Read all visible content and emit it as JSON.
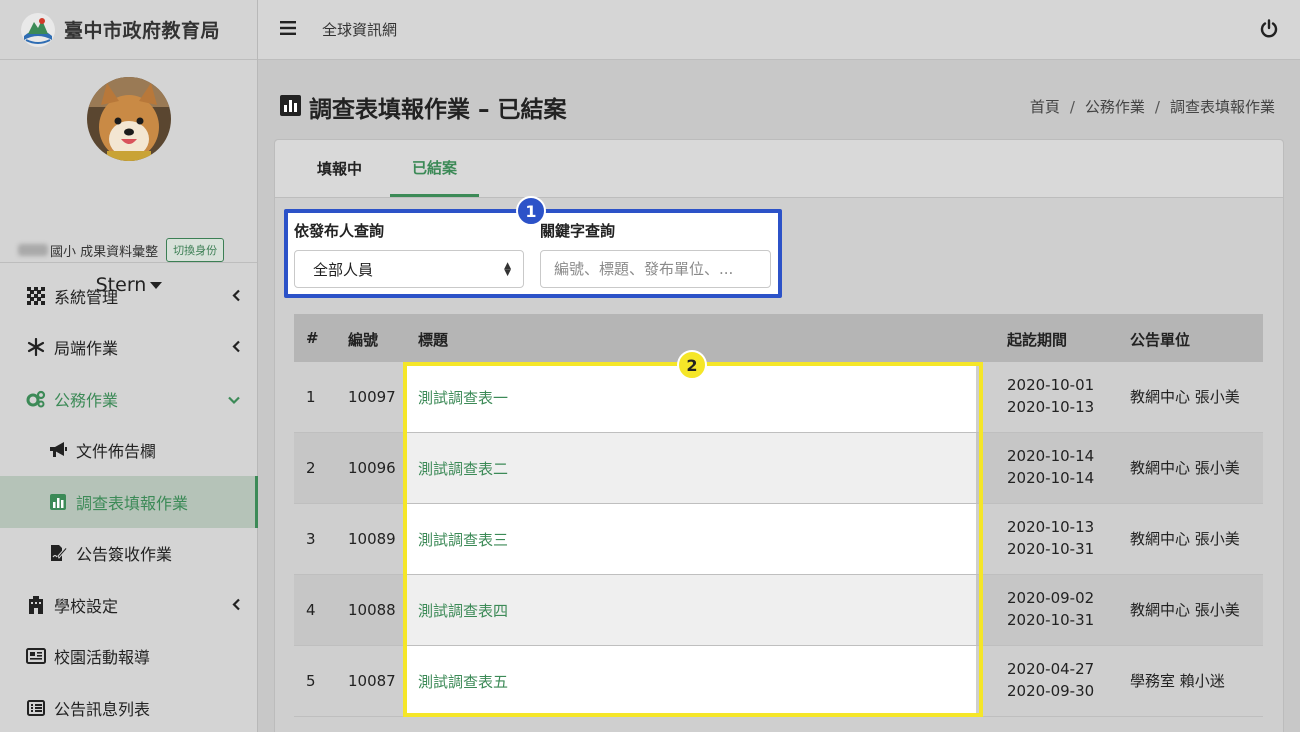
{
  "brand": {
    "title": "臺中市政府教育局"
  },
  "user": {
    "role_text": "國小 成果資料彙整",
    "switch_label": "切換身份",
    "name": "Stern"
  },
  "nav": [
    {
      "label": "系統管理",
      "icon": "grid-icon",
      "arrow": "chevron-left"
    },
    {
      "label": "局端作業",
      "icon": "snowflake-icon",
      "arrow": "chevron-left"
    },
    {
      "label": "公務作業",
      "icon": "gears-icon",
      "arrow": "chevron-down",
      "state": "open"
    },
    {
      "label": "文件佈告欄",
      "icon": "megaphone-icon",
      "sub": true
    },
    {
      "label": "調查表填報作業",
      "icon": "bar-chart-icon",
      "sub": true,
      "state": "active"
    },
    {
      "label": "公告簽收作業",
      "icon": "signature-icon",
      "sub": true
    },
    {
      "label": "學校設定",
      "icon": "school-icon",
      "arrow": "chevron-left"
    },
    {
      "label": "校園活動報導",
      "icon": "newspaper-icon"
    },
    {
      "label": "公告訊息列表",
      "icon": "list-icon"
    }
  ],
  "topbar": {
    "link": "全球資訊網"
  },
  "page": {
    "title": "調查表填報作業 – 已結案",
    "breadcrumb": [
      "首頁",
      "公務作業",
      "調查表填報作業"
    ]
  },
  "tabs": [
    "填報中",
    "已結案"
  ],
  "filter": {
    "publisher_label": "依發布人查詢",
    "publisher_value": "全部人員",
    "keyword_label": "關鍵字查詢",
    "keyword_placeholder": "編號、標題、發布單位、..."
  },
  "badges": [
    "1",
    "2"
  ],
  "table": {
    "headers": [
      "#",
      "編號",
      "標題",
      "起訖期間",
      "公告單位"
    ],
    "rows": [
      {
        "no": "1",
        "id": "10097",
        "title": "測試調查表一",
        "start": "2020-10-01",
        "end": "2020-10-13",
        "unit": "教網中心 張小美"
      },
      {
        "no": "2",
        "id": "10096",
        "title": "測試調查表二",
        "start": "2020-10-14",
        "end": "2020-10-14",
        "unit": "教網中心 張小美"
      },
      {
        "no": "3",
        "id": "10089",
        "title": "測試調查表三",
        "start": "2020-10-13",
        "end": "2020-10-31",
        "unit": "教網中心 張小美"
      },
      {
        "no": "4",
        "id": "10088",
        "title": "測試調查表四",
        "start": "2020-09-02",
        "end": "2020-10-31",
        "unit": "教網中心 張小美"
      },
      {
        "no": "5",
        "id": "10087",
        "title": "測試調查表五",
        "start": "2020-04-27",
        "end": "2020-09-30",
        "unit": "學務室 賴小迷"
      }
    ]
  },
  "colors": {
    "accent_green": "#3c8a57",
    "highlight_blue": "#2c52c8",
    "highlight_yellow": "#f5e628"
  }
}
